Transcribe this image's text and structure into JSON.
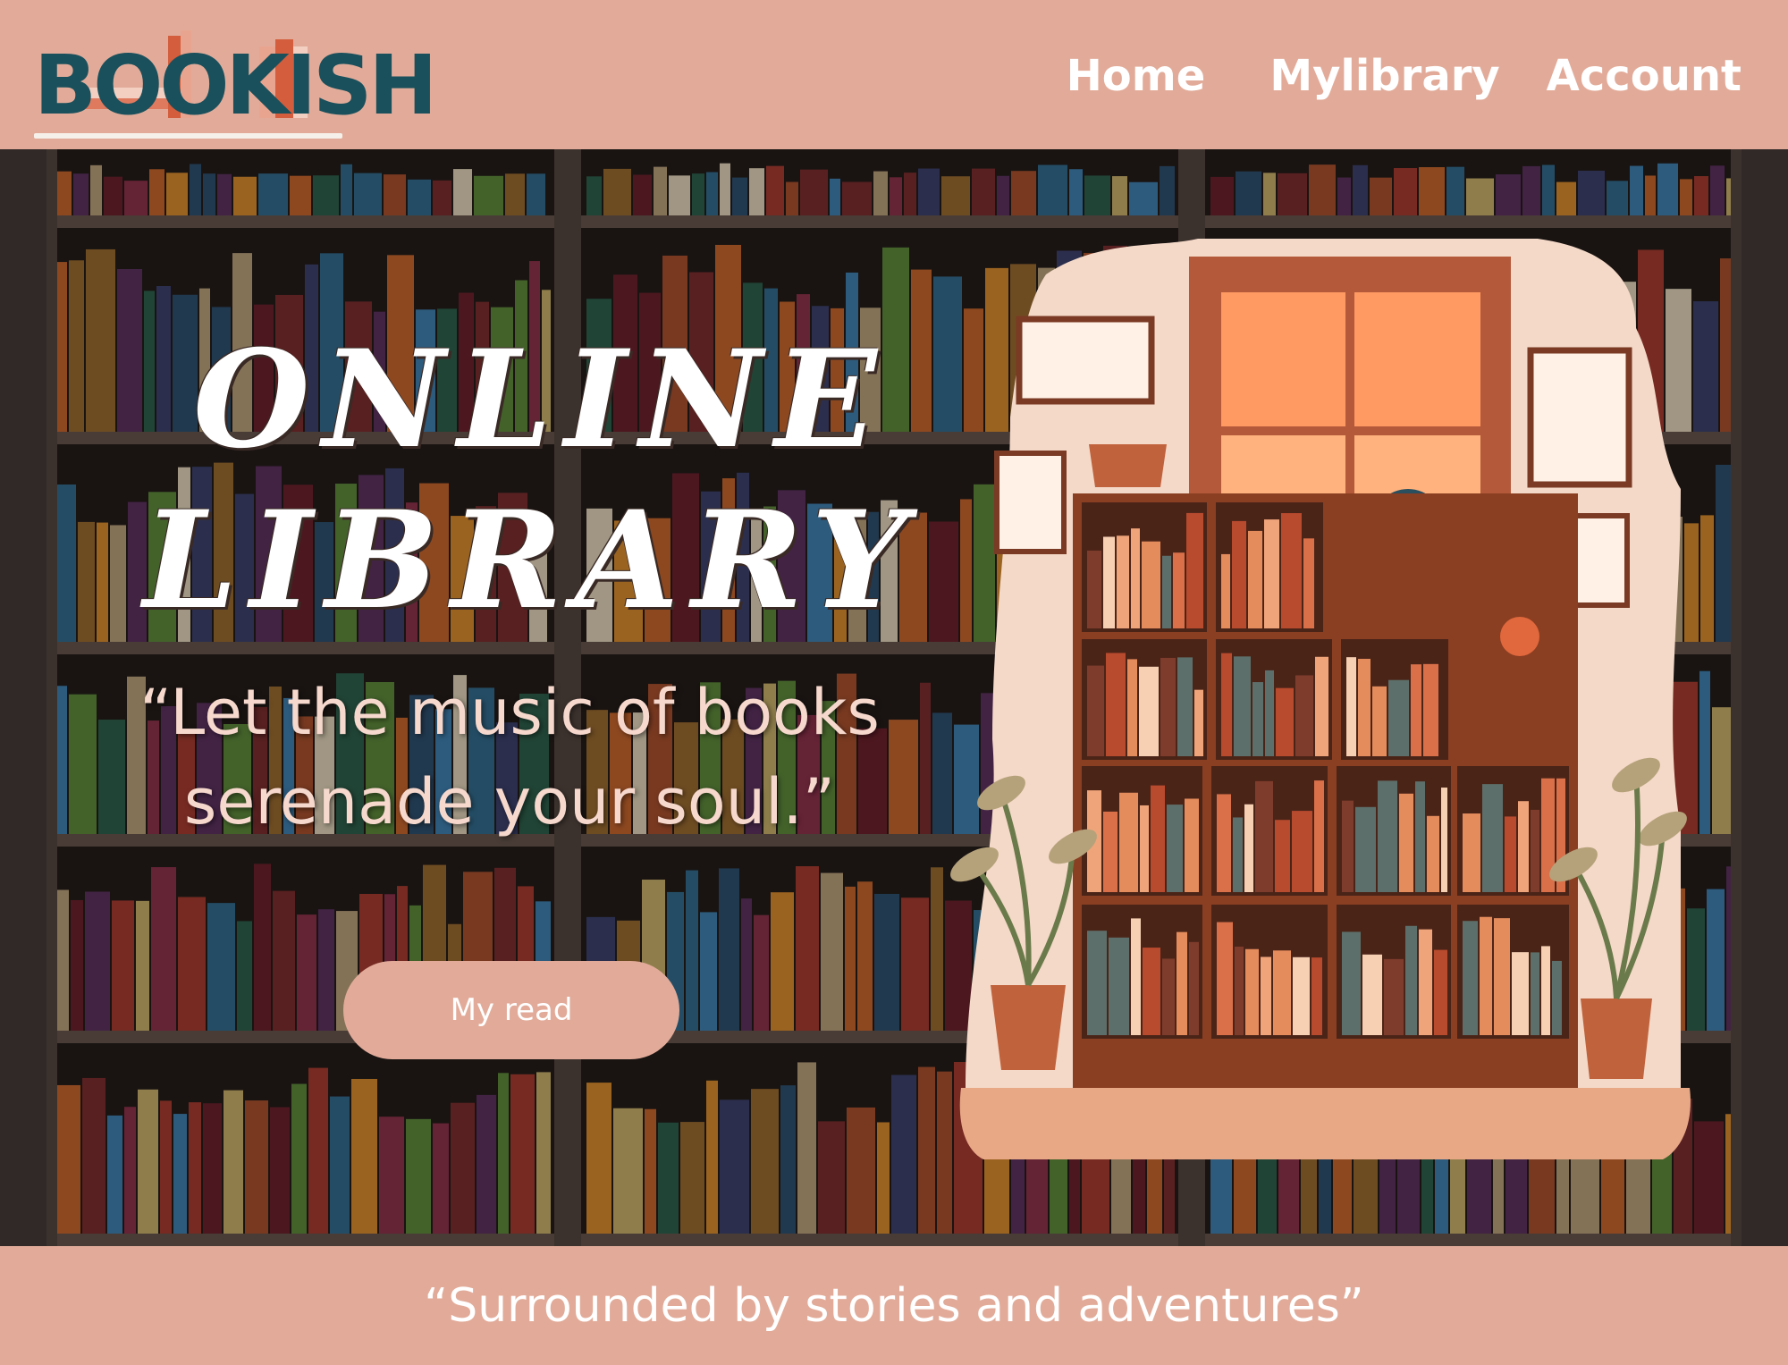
{
  "header": {
    "logo_text": "BOOKISH",
    "nav": {
      "home": "Home",
      "library": "Mylibrary",
      "account": "Account"
    }
  },
  "hero": {
    "title_line1": "ONLINE",
    "title_line2": "LIBRARY",
    "quote_line1": "“Let the music of books",
    "quote_line2": "serenade your soul.”",
    "button_label": "My read"
  },
  "footer": {
    "tagline": "“Surrounded by stories and adventures”"
  },
  "colors": {
    "brand": "#e2ab99",
    "logo_teal": "#19505c",
    "logo_accent": "#d35d3c",
    "quote_text": "#f6d8cd"
  }
}
